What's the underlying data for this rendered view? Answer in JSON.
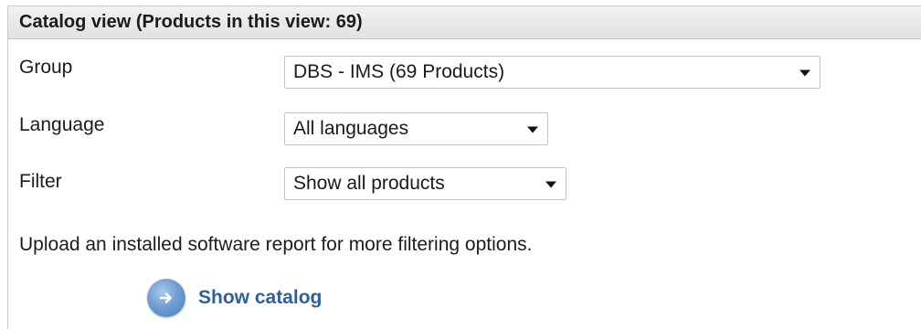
{
  "panel": {
    "title": "Catalog view (Products in this view: 69)"
  },
  "form": {
    "group": {
      "label": "Group",
      "selected": "DBS - IMS (69 Products)"
    },
    "language": {
      "label": "Language",
      "selected": "All languages"
    },
    "filter": {
      "label": "Filter",
      "selected": "Show all products"
    }
  },
  "info_text": "Upload an installed software report for more filtering options.",
  "action": {
    "label": "Show catalog",
    "icon": "arrow-right-icon"
  },
  "colors": {
    "link": "#2f5f99",
    "button": "#6f9ed3",
    "header_bg": "#e9e9e9"
  }
}
